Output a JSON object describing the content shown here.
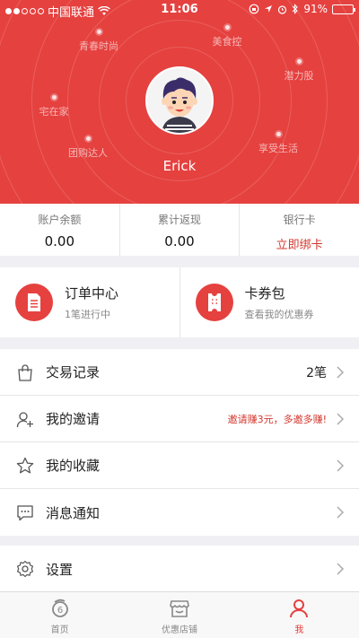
{
  "status_bar": {
    "carrier": "中国联通",
    "time": "11:06",
    "battery": "91%",
    "battery_level": 0.91
  },
  "profile": {
    "username": "Erick",
    "interest_tags": [
      "青春时尚",
      "美食控",
      "潜力股",
      "宅在家",
      "团购达人",
      "享受生活"
    ]
  },
  "stats": [
    {
      "label": "账户余额",
      "value": "0.00"
    },
    {
      "label": "累计返现",
      "value": "0.00"
    },
    {
      "label": "银行卡",
      "value": "立即绑卡"
    }
  ],
  "cards": [
    {
      "title": "订单中心",
      "subtitle": "1笔进行中",
      "icon": "document-icon"
    },
    {
      "title": "卡券包",
      "subtitle": "查看我的优惠券",
      "icon": "ticket-icon"
    }
  ],
  "menu": [
    {
      "label": "交易记录",
      "right": "2笔",
      "icon": "shopping-bag-icon"
    },
    {
      "label": "我的邀请",
      "right": "邀请赚3元，多邀多赚!",
      "icon": "invite-user-icon"
    },
    {
      "label": "我的收藏",
      "right": "",
      "icon": "star-icon"
    },
    {
      "label": "消息通知",
      "right": "",
      "icon": "message-icon"
    }
  ],
  "menu2": [
    {
      "label": "设置",
      "icon": "gear-icon"
    }
  ],
  "tabbar": [
    {
      "label": "首页",
      "icon": "home-logo-icon",
      "active": false
    },
    {
      "label": "优惠店铺",
      "icon": "store-icon",
      "active": false
    },
    {
      "label": "我",
      "icon": "user-icon",
      "active": true
    }
  ],
  "colors": {
    "brand_red": "#e5413f",
    "accent_text_red": "#d3382f",
    "battery_green": "#4cd964"
  }
}
